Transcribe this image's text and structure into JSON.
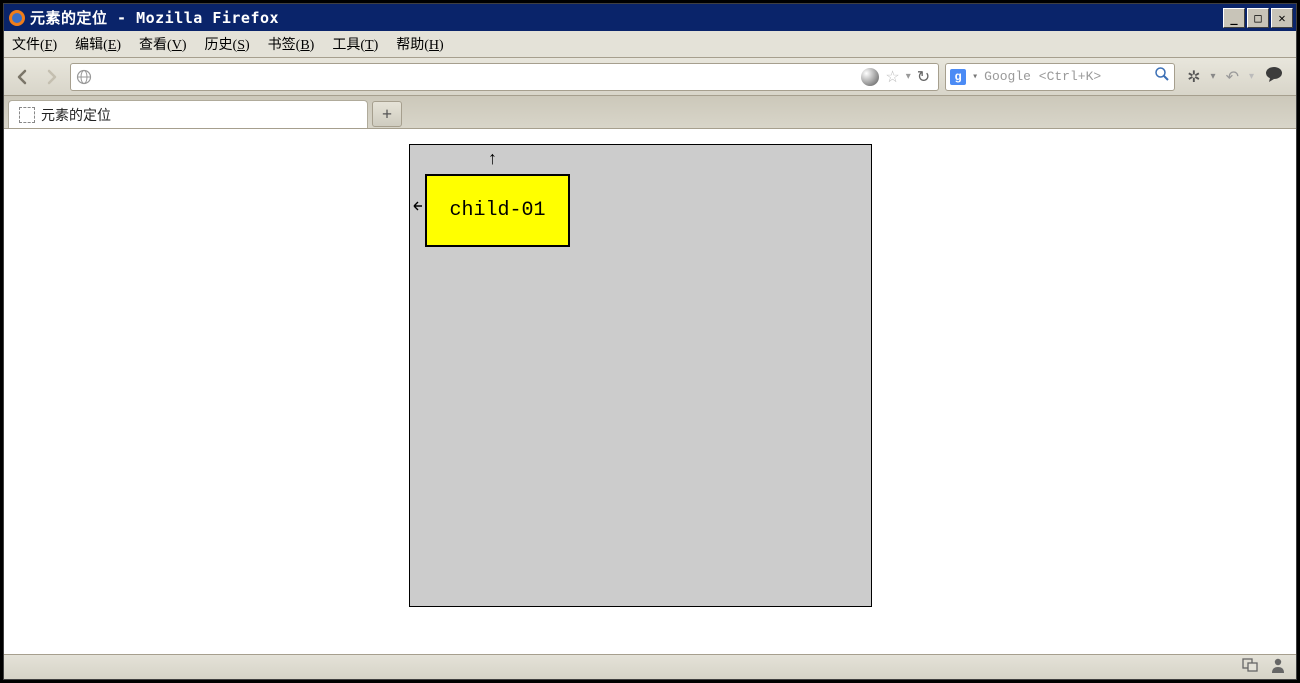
{
  "window": {
    "title": "元素的定位 - Mozilla Firefox"
  },
  "menu": {
    "items": [
      {
        "label": "文件",
        "ul": "F"
      },
      {
        "label": "编辑",
        "ul": "E"
      },
      {
        "label": "查看",
        "ul": "V"
      },
      {
        "label": "历史",
        "ul": "S"
      },
      {
        "label": "书签",
        "ul": "B"
      },
      {
        "label": "工具",
        "ul": "T"
      },
      {
        "label": "帮助",
        "ul": "H"
      }
    ]
  },
  "urlbar": {
    "value": ""
  },
  "searchbar": {
    "engine_letter": "g",
    "placeholder": "Google <Ctrl+K>"
  },
  "tab": {
    "title": "元素的定位",
    "newtab_symbol": "+"
  },
  "content": {
    "child_label": "child-01",
    "arrow_up": "↑",
    "arrow_left": "⇠"
  },
  "wincontrols": {
    "min": "_",
    "max": "□",
    "close": "✕"
  }
}
